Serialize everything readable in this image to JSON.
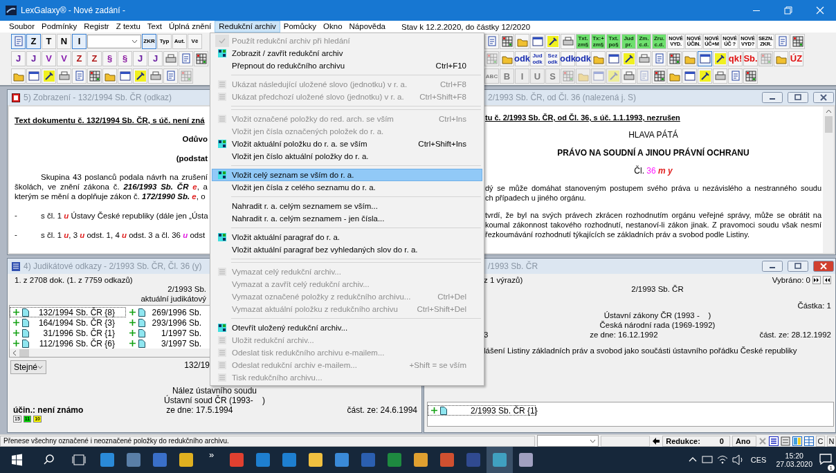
{
  "window": {
    "title": "LexGalaxy® - Nové zadání -"
  },
  "menu_bar": {
    "items": [
      {
        "label": "Soubor",
        "selected": false
      },
      {
        "label": "Podmínky",
        "selected": false
      },
      {
        "label": "Registr",
        "selected": false
      },
      {
        "label": "Z textu",
        "selected": false
      },
      {
        "label": "Text",
        "selected": false
      },
      {
        "label": "Úplná znění",
        "selected": false
      },
      {
        "label": "Redukční archiv",
        "selected": true
      },
      {
        "label": "Pomůcky",
        "selected": false
      },
      {
        "label": "Okno",
        "selected": false
      },
      {
        "label": "Nápověda",
        "selected": false
      }
    ],
    "status": "Stav k 12.2.2020, do částky 12/2020"
  },
  "toolbar": {
    "rows": [
      {
        "left": [
          {
            "kind": "icon",
            "pressed": true,
            "disabled": false
          },
          {
            "kind": "text",
            "label": "Z",
            "pressed": true,
            "disabled": false
          },
          {
            "kind": "text",
            "label": "T",
            "pressed": false,
            "disabled": false
          },
          {
            "kind": "text",
            "label": "N",
            "pressed": false,
            "disabled": false
          },
          {
            "kind": "text",
            "label": "I",
            "pressed": true,
            "disabled": false
          },
          {
            "kind": "combo",
            "pressed": false,
            "disabled": false
          },
          {
            "kind": "small",
            "label": "ZKR",
            "pressed": true,
            "disabled": false
          },
          {
            "kind": "small",
            "label": "Typ",
            "pressed": false,
            "disabled": false
          },
          {
            "kind": "small",
            "label": "Aut.",
            "pressed": false,
            "disabled": false
          },
          {
            "kind": "small",
            "label": "Vě",
            "pressed": false,
            "disabled": false
          }
        ],
        "right": [
          {
            "kind": "icon",
            "pressed": false,
            "disabled": false
          },
          {
            "kind": "icon",
            "pressed": false,
            "disabled": false
          },
          {
            "kind": "icon",
            "pressed": false,
            "disabled": false
          },
          {
            "kind": "icon",
            "pressed": false,
            "disabled": false
          },
          {
            "kind": "icon",
            "pressed": false,
            "disabled": false
          },
          {
            "kind": "icon",
            "pressed": false,
            "disabled": false
          },
          {
            "kind": "green",
            "label": "Txt. zm§",
            "pressed": false,
            "disabled": false
          },
          {
            "kind": "green",
            "label": "Tx:+ zm§",
            "pressed": false,
            "disabled": false
          },
          {
            "kind": "green",
            "label": "Txt. po§",
            "pressed": false,
            "disabled": false
          },
          {
            "kind": "green",
            "label": "Jud pr.",
            "pressed": false,
            "disabled": false
          },
          {
            "kind": "green",
            "label": "Zm. c.d.",
            "pressed": false,
            "disabled": false
          },
          {
            "kind": "green",
            "label": "Zru. c.d.",
            "pressed": false,
            "disabled": false
          },
          {
            "kind": "tiny",
            "label": "NOVÉ VYD.",
            "pressed": false,
            "disabled": false
          },
          {
            "kind": "tiny",
            "label": "NOVÉ ÚČIN.",
            "pressed": false,
            "disabled": false
          },
          {
            "kind": "tiny",
            "label": "NOVÉ ÚČ+M",
            "pressed": false,
            "disabled": false
          },
          {
            "kind": "tiny",
            "label": "NOVÉ ÚČ ?",
            "pressed": false,
            "disabled": false
          },
          {
            "kind": "tiny",
            "label": "NOVÉ VYD?",
            "pressed": false,
            "disabled": false
          },
          {
            "kind": "tiny",
            "label": "SEZN. ZKR.",
            "pressed": false,
            "disabled": false
          },
          {
            "kind": "icon",
            "pressed": false,
            "disabled": false
          },
          {
            "kind": "icon",
            "pressed": false,
            "disabled": false
          }
        ]
      },
      {
        "left": [
          {
            "kind": "text",
            "label": "J",
            "color": "#6a1fa0",
            "pressed": false,
            "disabled": false
          },
          {
            "kind": "text",
            "label": "J",
            "color": "#6a1fa0",
            "pressed": false,
            "disabled": false
          },
          {
            "kind": "text",
            "label": "V",
            "color": "#8a22b0",
            "pressed": false,
            "disabled": false
          },
          {
            "kind": "text",
            "label": "V",
            "color": "#8a22b0",
            "pressed": false,
            "disabled": false
          },
          {
            "kind": "text",
            "label": "Z",
            "color": "#b01818",
            "pressed": false,
            "disabled": false
          },
          {
            "kind": "text",
            "label": "Z",
            "color": "#b01818",
            "pressed": false,
            "disabled": false
          },
          {
            "kind": "text",
            "label": "§",
            "color": "#8a1aa0",
            "pressed": false,
            "disabled": false
          },
          {
            "kind": "text",
            "label": "§",
            "color": "#8a1aa0",
            "pressed": false,
            "disabled": false
          },
          {
            "kind": "text",
            "label": "J",
            "color": "#6a1fa0",
            "pressed": false,
            "disabled": false
          },
          {
            "kind": "text",
            "label": "J",
            "color": "#6a1fa0",
            "pressed": false,
            "disabled": false
          },
          {
            "kind": "icon",
            "pressed": false,
            "disabled": false
          },
          {
            "kind": "icon",
            "pressed": false,
            "disabled": false
          },
          {
            "kind": "icon",
            "pressed": false,
            "disabled": false
          }
        ],
        "right": [
          {
            "kind": "icon",
            "pressed": false,
            "disabled": true
          },
          {
            "kind": "icon",
            "pressed": false,
            "disabled": false
          },
          {
            "kind": "text",
            "label": "odk",
            "color": "#1a2fb0",
            "pressed": false,
            "disabled": false
          },
          {
            "kind": "small",
            "label": "Jud odk",
            "color": "#1a2fb0",
            "pressed": false,
            "disabled": false
          },
          {
            "kind": "small",
            "label": "Sez odk",
            "color": "#1a2fb0",
            "pressed": false,
            "disabled": false
          },
          {
            "kind": "text",
            "label": "odk",
            "color": "#1a2fb0",
            "pressed": false,
            "disabled": false
          },
          {
            "kind": "text",
            "label": "odk",
            "color": "#1a2fb0",
            "pressed": false,
            "disabled": false
          },
          {
            "kind": "icon",
            "pressed": false,
            "disabled": false
          },
          {
            "kind": "icon",
            "pressed": false,
            "disabled": false
          },
          {
            "kind": "icon",
            "pressed": false,
            "disabled": false
          },
          {
            "kind": "icon",
            "pressed": false,
            "disabled": false
          },
          {
            "kind": "icon",
            "pressed": false,
            "disabled": false
          },
          {
            "kind": "icon",
            "pressed": false,
            "disabled": false
          },
          {
            "kind": "icon",
            "pressed": false,
            "disabled": false
          },
          {
            "kind": "icon",
            "pressed": true,
            "disabled": false
          },
          {
            "kind": "icon",
            "pressed": false,
            "disabled": false
          },
          {
            "kind": "text",
            "label": "qk!",
            "color": "#e01010",
            "pressed": false,
            "disabled": false
          },
          {
            "kind": "text",
            "label": "Sb.",
            "color": "#e01010",
            "pressed": false,
            "disabled": false
          },
          {
            "kind": "icon",
            "pressed": false,
            "disabled": true
          },
          {
            "kind": "icon",
            "pressed": false,
            "disabled": false
          },
          {
            "kind": "text",
            "label": "ÚZ",
            "color": "#e01010",
            "pressed": false,
            "disabled": false
          }
        ]
      },
      {
        "left": [
          {
            "kind": "icon",
            "pressed": false,
            "disabled": false
          },
          {
            "kind": "icon",
            "pressed": false,
            "disabled": false
          },
          {
            "kind": "icon",
            "pressed": false,
            "disabled": false
          },
          {
            "kind": "icon",
            "pressed": false,
            "disabled": false
          },
          {
            "kind": "icon",
            "pressed": false,
            "disabled": false
          },
          {
            "kind": "icon",
            "pressed": false,
            "disabled": false
          },
          {
            "kind": "icon",
            "pressed": false,
            "disabled": false
          },
          {
            "kind": "icon",
            "pressed": false,
            "disabled": false
          },
          {
            "kind": "icon",
            "pressed": false,
            "disabled": false
          },
          {
            "kind": "icon",
            "pressed": false,
            "disabled": false
          },
          {
            "kind": "icon",
            "pressed": false,
            "disabled": false
          },
          {
            "kind": "icon",
            "pressed": false,
            "disabled": true
          }
        ],
        "right": [
          {
            "kind": "small",
            "label": "ABC",
            "pressed": false,
            "disabled": true
          },
          {
            "kind": "text",
            "label": "B",
            "pressed": false,
            "disabled": true
          },
          {
            "kind": "text",
            "label": "I",
            "pressed": false,
            "disabled": true
          },
          {
            "kind": "text",
            "label": "U",
            "pressed": false,
            "disabled": true
          },
          {
            "kind": "text",
            "label": "S",
            "pressed": false,
            "disabled": true
          },
          {
            "kind": "icon",
            "pressed": false,
            "disabled": true
          },
          {
            "kind": "icon",
            "pressed": false,
            "disabled": true
          },
          {
            "kind": "icon",
            "pressed": false,
            "disabled": true
          },
          {
            "kind": "icon",
            "pressed": false,
            "disabled": true
          },
          {
            "kind": "icon",
            "pressed": false,
            "disabled": false
          },
          {
            "kind": "icon",
            "pressed": false,
            "disabled": true
          },
          {
            "kind": "icon",
            "pressed": false,
            "disabled": false
          },
          {
            "kind": "icon",
            "pressed": false,
            "disabled": false
          },
          {
            "kind": "icon",
            "pressed": false,
            "disabled": false
          },
          {
            "kind": "icon",
            "pressed": false,
            "disabled": false
          },
          {
            "kind": "icon",
            "pressed": false,
            "disabled": false
          },
          {
            "kind": "icon",
            "pressed": false,
            "disabled": false
          },
          {
            "kind": "icon",
            "pressed": false,
            "disabled": false
          }
        ]
      }
    ]
  },
  "display_window": {
    "title": "5) Zobrazení - 132/1994 Sb. ČR (odkaz)",
    "heading": "Text dokumentu č. 132/1994 Sb. ČR, s úč. není zná",
    "blocks": [
      {
        "kind": "right-bold",
        "lines": [
          [
            {
              "kind": "plain",
              "text": "Odůvo"
            }
          ]
        ]
      },
      {
        "kind": "right-bold",
        "lines": [
          [
            {
              "kind": "plain",
              "text": "(podstat"
            }
          ]
        ]
      },
      {
        "kind": "paragraph",
        "lines": [
          [
            {
              "kind": "plain",
              "text": "Skupina 43 poslanců podala návrh na zrušení"
            }
          ],
          [
            {
              "kind": "plain",
              "text": "školách, ve znění zákona č. "
            },
            {
              "kind": "ref",
              "text": "216/1993 Sb. ČR"
            },
            {
              "kind": "mark",
              "text": " e",
              "color": "#e02020"
            },
            {
              "kind": "plain",
              "text": ", a"
            }
          ],
          [
            {
              "kind": "plain",
              "text": "kterým se mění a doplňuje zákon č. "
            },
            {
              "kind": "ref",
              "text": "172/1990 Sb."
            },
            {
              "kind": "mark",
              "text": " e",
              "color": "#e02020"
            },
            {
              "kind": "plain",
              "text": ", o"
            }
          ]
        ]
      },
      {
        "kind": "dash",
        "bullet": "-",
        "lines": [
          [
            {
              "kind": "plain",
              "text": "s čl. 1 "
            },
            {
              "kind": "mark",
              "text": "u",
              "color": "#e02020"
            },
            {
              "kind": "plain",
              "text": " Ústavy České republiky (dále jen „Ústa"
            }
          ]
        ]
      },
      {
        "kind": "dash",
        "bullet": "-",
        "lines": [
          [
            {
              "kind": "plain",
              "text": "s čl. 1 "
            },
            {
              "kind": "mark",
              "text": "u",
              "color": "#e02020"
            },
            {
              "kind": "plain",
              "text": ", 3 "
            },
            {
              "kind": "mark",
              "text": "u",
              "color": "#e02020"
            },
            {
              "kind": "plain",
              "text": " odst. 1, 4 "
            },
            {
              "kind": "mark",
              "text": "u",
              "color": "#e02020"
            },
            {
              "kind": "plain",
              "text": " odst. 3 a čl. 36 "
            },
            {
              "kind": "mark",
              "text": "u",
              "color": "#e020e0"
            },
            {
              "kind": "plain",
              "text": " odst"
            }
          ]
        ]
      }
    ]
  },
  "text_window": {
    "title": "2/1993 Sb. ČR, od Čl. 36 (nalezená j. S)",
    "heading": "tu č. 2/1993 Sb. ČR, od Čl. 36, s úč. 1.1.1993, nezrušen",
    "blocks": [
      {
        "kind": "center",
        "lines": [
          [
            {
              "kind": "plain",
              "text": "HLAVA PÁTÁ"
            }
          ]
        ]
      },
      {
        "kind": "center-bold",
        "lines": [
          [
            {
              "kind": "plain",
              "text": "PRÁVO NA SOUDNÍ A JINOU PRÁVNÍ OCHRANU"
            }
          ]
        ]
      },
      {
        "kind": "center",
        "lines": [
          [
            {
              "kind": "plain",
              "text": "Čl. "
            },
            {
              "kind": "hit",
              "text": "36",
              "color": "#ff20ff"
            },
            {
              "kind": "mark",
              "text": " m y",
              "color": "#e02020"
            }
          ]
        ]
      },
      {
        "kind": "paragraph",
        "lines": [
          [
            {
              "kind": "plain",
              "text": "dý se může domáhat stanoveným postupem svého práva u nezávislého a nestranného soudu"
            }
          ],
          [
            {
              "kind": "plain",
              "text": "ch případech u jiného orgánu."
            }
          ]
        ]
      },
      {
        "kind": "paragraph",
        "lines": [
          [
            {
              "kind": "plain",
              "text": "tvrdí, že byl na svých právech zkrácen rozhodnutím orgánu veřejné správy, může se obrátit na"
            }
          ],
          [
            {
              "kind": "plain",
              "text": "koumal zákonnost takového rozhodnutí, nestanoví-li zákon jinak. Z pravomoci soudu však nesmí"
            }
          ],
          [
            {
              "kind": "plain",
              "text": "řezkoumávání rozhodnutí týkajících se základních práv a svobod podle Listiny."
            }
          ]
        ]
      }
    ]
  },
  "references_window": {
    "title": "4) Judikátové odkazy - 2/1993 Sb. ČR, Čl. 36 (y)",
    "summary": "1. z 2708 dok. (1. z 7759 odkazů)",
    "caption": [
      "2/1993 Sb.",
      "aktuální judikátový"
    ],
    "rows": [
      {
        "cells": [
          "132/1994 Sb. ČR {8}",
          "269/1996 Sb."
        ],
        "selected": true
      },
      {
        "cells": [
          "164/1994 Sb. ČR {3}",
          "293/1996 Sb."
        ],
        "selected": false
      },
      {
        "cells": [
          "31/1996 Sb. ČR {1}",
          "1/1997 Sb."
        ],
        "selected": false
      },
      {
        "cells": [
          "112/1996 Sb. ČR {6}",
          "3/1997 Sb."
        ],
        "selected": false
      }
    ],
    "filter": "Stejné",
    "number": "132/19",
    "court": [
      "Nález ústavního soudu",
      "Ústavní soud ČR (1993-    )"
    ],
    "validity": "účin.: není známo",
    "date": "ze dne: 17.5.1994",
    "part_date": "část. ze: 24.6.1994",
    "badges": [
      {
        "label": "15",
        "color": "#ffffff"
      },
      {
        "label": "11",
        "color": "#00e000"
      },
      {
        "label": "10",
        "color": "#ffff00"
      }
    ]
  },
  "detail_window": {
    "title": "/1993 Sb. ČR",
    "count": "z 1 výrazů)",
    "selected_count": "Vybráno: 0",
    "number": "2/1993 Sb. ČR",
    "part": "Částka: 1",
    "lines": [
      "Ústavní zákony ČR (1993 -    )",
      "Česká národní rada (1969-1992)"
    ],
    "left_cut": "3",
    "date": "ze dne: 16.12.1992",
    "part_date": "část. ze: 28.12.1992",
    "name": "lášení Listiny základních práv a svobod jako součásti ústavního pořádku České republiky",
    "list": [
      {
        "label": "2/1993 Sb. ČR {1}",
        "selected": true
      }
    ]
  },
  "menu": {
    "items": [
      {
        "kind": "item",
        "label": "Použít redukční archiv při hledání",
        "disabled": true,
        "checked": true,
        "icon": false,
        "selected": false
      },
      {
        "kind": "item",
        "label": "Zobrazit / zavřít redukční archiv",
        "disabled": false,
        "checked": false,
        "icon": true,
        "selected": false
      },
      {
        "kind": "item",
        "label": "Přepnout do redukčního archivu",
        "shortcut": "Ctrl+F10",
        "disabled": false,
        "checked": false,
        "icon": false,
        "selected": false
      },
      {
        "kind": "separator"
      },
      {
        "kind": "item",
        "label": "Ukázat následující uložené slovo (jednotku) v r. a.",
        "shortcut": "Ctrl+F8",
        "disabled": true,
        "checked": false,
        "icon": true,
        "selected": false
      },
      {
        "kind": "item",
        "label": "Ukázat předchozí uložené slovo (jednotku) v r. a.",
        "shortcut": "Ctrl+Shift+F8",
        "disabled": true,
        "checked": false,
        "icon": true,
        "selected": false
      },
      {
        "kind": "separator"
      },
      {
        "kind": "separator"
      },
      {
        "kind": "item",
        "label": "Vložit označené položky do red. arch. se vším",
        "shortcut": "Ctrl+Ins",
        "disabled": true,
        "checked": false,
        "icon": true,
        "selected": false
      },
      {
        "kind": "item",
        "label": "Vložit jen čísla označených položek do r. a.",
        "disabled": true,
        "checked": false,
        "icon": false,
        "selected": false
      },
      {
        "kind": "item",
        "label": "Vložit aktuální položku do r. a. se vším",
        "shortcut": "Ctrl+Shift+Ins",
        "disabled": false,
        "checked": false,
        "icon": true,
        "selected": false
      },
      {
        "kind": "item",
        "label": "Vložit jen číslo aktuální položky do r. a.",
        "disabled": false,
        "checked": false,
        "icon": false,
        "selected": false
      },
      {
        "kind": "separator"
      },
      {
        "kind": "item",
        "label": "Vložit celý seznam se vším do r. a.",
        "disabled": false,
        "checked": false,
        "icon": true,
        "selected": true
      },
      {
        "kind": "item",
        "label": "Vložit jen čísla z celého seznamu do r. a.",
        "disabled": false,
        "checked": false,
        "icon": false,
        "selected": false
      },
      {
        "kind": "separator"
      },
      {
        "kind": "item",
        "label": "Nahradit r. a. celým seznamem se vším...",
        "disabled": false,
        "checked": false,
        "icon": false,
        "selected": false
      },
      {
        "kind": "item",
        "label": "Nahradit r. a. celým seznamem - jen čísla...",
        "disabled": false,
        "checked": false,
        "icon": false,
        "selected": false
      },
      {
        "kind": "separator"
      },
      {
        "kind": "item",
        "label": "Vložit aktuální paragraf do r. a.",
        "disabled": false,
        "checked": false,
        "icon": true,
        "selected": false
      },
      {
        "kind": "item",
        "label": "Vložit aktuální paragraf bez vyhledaných slov do r. a.",
        "disabled": false,
        "checked": false,
        "icon": false,
        "selected": false
      },
      {
        "kind": "separator"
      },
      {
        "kind": "separator"
      },
      {
        "kind": "item",
        "label": "Vymazat celý redukční archiv...",
        "disabled": true,
        "checked": false,
        "icon": true,
        "selected": false
      },
      {
        "kind": "item",
        "label": "Vymazat a zavřít celý redukční archiv...",
        "disabled": true,
        "checked": false,
        "icon": false,
        "selected": false
      },
      {
        "kind": "item",
        "label": "Vymazat označené položky z redukčního archivu...",
        "shortcut": "Ctrl+Del",
        "disabled": true,
        "checked": false,
        "icon": false,
        "selected": false
      },
      {
        "kind": "item",
        "label": "Vymazat aktuální položku z redukčního archivu",
        "shortcut": "Ctrl+Shift+Del",
        "disabled": true,
        "checked": false,
        "icon": false,
        "selected": false
      },
      {
        "kind": "separator"
      },
      {
        "kind": "item",
        "label": "Otevřít uložený redukční archiv...",
        "disabled": false,
        "checked": false,
        "icon": true,
        "selected": false
      },
      {
        "kind": "item",
        "label": "Uložit redukční archiv...",
        "disabled": true,
        "checked": false,
        "icon": true,
        "selected": false
      },
      {
        "kind": "item",
        "label": "Odeslat tisk redukčního archivu e-mailem...",
        "disabled": true,
        "checked": false,
        "icon": true,
        "selected": false
      },
      {
        "kind": "item",
        "label": "Odeslat redukční archiv e-mailem...",
        "shortcut": "+Shift = se vším",
        "disabled": true,
        "checked": false,
        "icon": true,
        "selected": false
      },
      {
        "kind": "item",
        "label": "Tisk redukčního archivu...",
        "disabled": true,
        "checked": false,
        "icon": true,
        "selected": false
      }
    ]
  },
  "status_bar": {
    "message": "Přenese všechny označené i neoznačené položky do redukčního archivu.",
    "reduction_label": "Redukce:",
    "reduction_value": "0",
    "answer": "Ano",
    "toggles": [
      "C",
      "N"
    ]
  },
  "taskbar": {
    "overflow": "»",
    "apps": [
      {
        "color": "#2a8ad8",
        "selected": false
      },
      {
        "color": "#5a7fa8",
        "selected": false
      },
      {
        "color": "#3a6fc8",
        "selected": false
      },
      {
        "color": "#e0b020",
        "selected": false
      },
      {
        "color": "#e04030",
        "selected": false
      },
      {
        "color": "#1e7fd0",
        "selected": false
      },
      {
        "color": "#1e7fd0",
        "selected": false
      },
      {
        "color": "#f0c040",
        "selected": false
      },
      {
        "color": "#3a8ad8",
        "selected": false
      },
      {
        "color": "#2b5fb0",
        "selected": false
      },
      {
        "color": "#1e8a40",
        "selected": false
      },
      {
        "color": "#e0a030",
        "selected": false
      },
      {
        "color": "#d05030",
        "selected": false
      },
      {
        "color": "#304a90",
        "selected": false
      },
      {
        "color": "#40a0c0",
        "selected": true
      },
      {
        "color": "#a0a0c0",
        "selected": false
      }
    ],
    "language": "CES",
    "time": "15:20",
    "date": "27.03.2020",
    "notifications": "1"
  }
}
